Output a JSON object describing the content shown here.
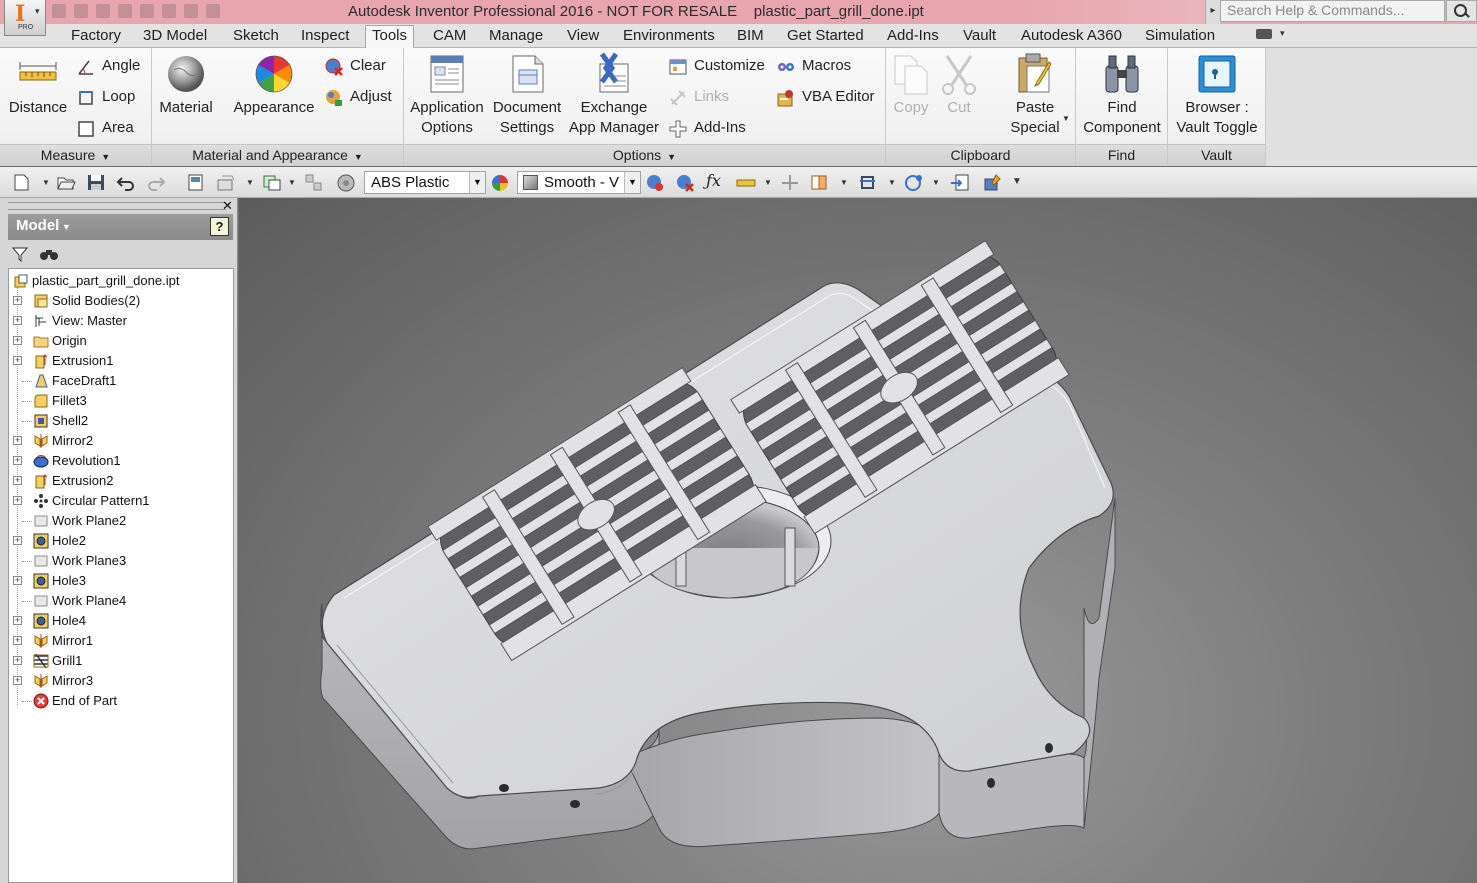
{
  "window": {
    "title": "Autodesk Inventor Professional 2016 - NOT FOR RESALE    plastic_part_grill_done.ipt",
    "search_placeholder": "Search Help & Commands...",
    "app_badge": "PRO"
  },
  "tabs": [
    {
      "label": "Factory",
      "active": false
    },
    {
      "label": "3D Model",
      "active": false
    },
    {
      "label": "Sketch",
      "active": false
    },
    {
      "label": "Inspect",
      "active": false
    },
    {
      "label": "Tools",
      "active": true
    },
    {
      "label": "CAM",
      "active": false
    },
    {
      "label": "Manage",
      "active": false
    },
    {
      "label": "View",
      "active": false
    },
    {
      "label": "Environments",
      "active": false
    },
    {
      "label": "BIM",
      "active": false
    },
    {
      "label": "Get Started",
      "active": false
    },
    {
      "label": "Add-Ins",
      "active": false
    },
    {
      "label": "Vault",
      "active": false
    },
    {
      "label": "Autodesk A360",
      "active": false
    },
    {
      "label": "Simulation",
      "active": false
    }
  ],
  "ribbon": {
    "measure": {
      "title": "Measure",
      "distance": "Distance",
      "angle": "Angle",
      "loop": "Loop",
      "area": "Area"
    },
    "material_appearance": {
      "title": "Material and Appearance",
      "material": "Material",
      "appearance": "Appearance",
      "clear": "Clear",
      "adjust": "Adjust"
    },
    "options": {
      "title": "Options",
      "app_options_1": "Application",
      "app_options_2": "Options",
      "doc_settings_1": "Document",
      "doc_settings_2": "Settings",
      "exchange_1": "Exchange",
      "exchange_2": "App Manager",
      "customize": "Customize",
      "links": "Links",
      "addins": "Add-Ins",
      "macros": "Macros",
      "vba": "VBA Editor"
    },
    "clipboard": {
      "title": "Clipboard",
      "copy": "Copy",
      "cut": "Cut",
      "paste_1": "Paste",
      "paste_2": "Special"
    },
    "find": {
      "title": "Find",
      "find_1": "Find",
      "find_2": "Component"
    },
    "vault": {
      "title": "Vault",
      "browser_1": "Browser :",
      "browser_2": "Vault Toggle"
    }
  },
  "toolbar": {
    "material_value": "ABS Plastic",
    "appearance_value": "Smooth - V"
  },
  "browser": {
    "header": "Model",
    "help": "?",
    "items": [
      {
        "label": "plastic_part_grill_done.ipt",
        "expandable": false,
        "icon": "part-icon"
      },
      {
        "label": "Solid Bodies(2)",
        "expandable": true,
        "icon": "solid-bodies-icon"
      },
      {
        "label": "View: Master",
        "expandable": true,
        "icon": "view-icon"
      },
      {
        "label": "Origin",
        "expandable": true,
        "icon": "folder-icon"
      },
      {
        "label": "Extrusion1",
        "expandable": true,
        "icon": "extrusion-icon"
      },
      {
        "label": "FaceDraft1",
        "expandable": false,
        "icon": "face-draft-icon"
      },
      {
        "label": "Fillet3",
        "expandable": false,
        "icon": "fillet-icon"
      },
      {
        "label": "Shell2",
        "expandable": false,
        "icon": "shell-icon"
      },
      {
        "label": "Mirror2",
        "expandable": true,
        "icon": "mirror-icon"
      },
      {
        "label": "Revolution1",
        "expandable": true,
        "icon": "revolve-icon"
      },
      {
        "label": "Extrusion2",
        "expandable": true,
        "icon": "extrusion-icon"
      },
      {
        "label": "Circular Pattern1",
        "expandable": true,
        "icon": "circular-pattern-icon"
      },
      {
        "label": "Work Plane2",
        "expandable": false,
        "icon": "work-plane-icon"
      },
      {
        "label": "Hole2",
        "expandable": true,
        "icon": "hole-icon"
      },
      {
        "label": "Work Plane3",
        "expandable": false,
        "icon": "work-plane-icon"
      },
      {
        "label": "Hole3",
        "expandable": true,
        "icon": "hole-icon"
      },
      {
        "label": "Work Plane4",
        "expandable": false,
        "icon": "work-plane-icon"
      },
      {
        "label": "Hole4",
        "expandable": true,
        "icon": "hole-icon"
      },
      {
        "label": "Mirror1",
        "expandable": true,
        "icon": "mirror-icon"
      },
      {
        "label": "Grill1",
        "expandable": true,
        "icon": "grill-icon"
      },
      {
        "label": "Mirror3",
        "expandable": true,
        "icon": "mirror-icon"
      },
      {
        "label": "End of Part",
        "expandable": false,
        "icon": "end-of-part-icon"
      }
    ]
  },
  "colors": {
    "title_bar": "#e8a5ad",
    "viewport": "#7c7c7c",
    "part": "#d3d3d6"
  }
}
